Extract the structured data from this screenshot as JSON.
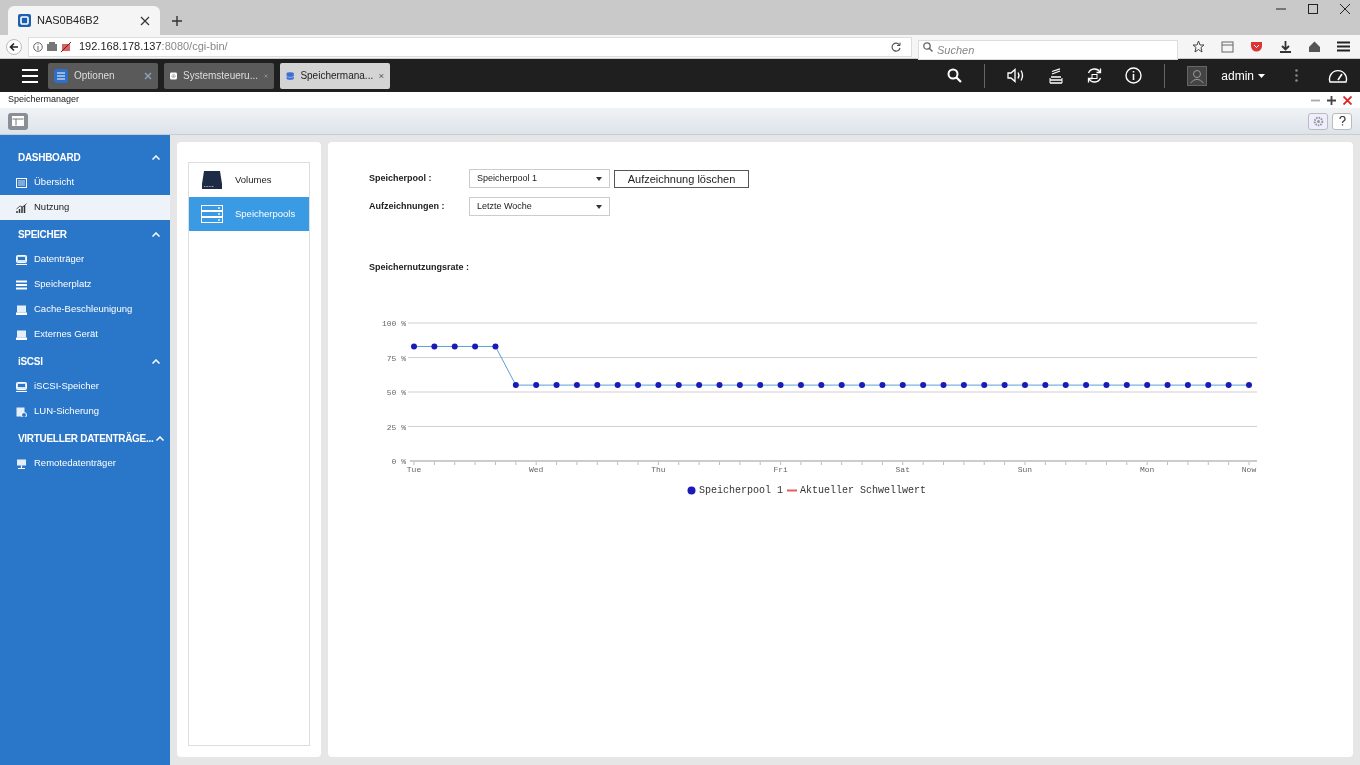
{
  "browser": {
    "tab_title": "NAS0B46B2",
    "url_host": "192.168.178.137",
    "url_rest": ":8080/cgi-bin/",
    "search": {
      "placeholder": "Suchen"
    }
  },
  "app_bar": {
    "tabs": [
      {
        "label": "Optionen",
        "selected": false
      },
      {
        "label": "Systemsteueru...",
        "selected": false
      },
      {
        "label": "Speichermana...",
        "selected": true
      }
    ],
    "user": "admin"
  },
  "window": {
    "title": "Speichermanager"
  },
  "sidebar": {
    "sections": [
      {
        "title": "DASHBOARD",
        "expanded": true,
        "items": [
          {
            "label": "Übersicht",
            "selected": false
          },
          {
            "label": "Nutzung",
            "selected": true
          }
        ]
      },
      {
        "title": "SPEICHER",
        "expanded": true,
        "items": [
          {
            "label": "Datenträger",
            "selected": false
          },
          {
            "label": "Speicherplatz",
            "selected": false
          },
          {
            "label": "Cache-Beschleunigung",
            "selected": false
          },
          {
            "label": "Externes Gerät",
            "selected": false
          }
        ]
      },
      {
        "title": "iSCSI",
        "expanded": true,
        "items": [
          {
            "label": "iSCSI-Speicher",
            "selected": false
          },
          {
            "label": "LUN-Sicherung",
            "selected": false
          }
        ]
      },
      {
        "title": "VIRTUELLER DATENTRÄGE...",
        "expanded": true,
        "items": [
          {
            "label": "Remotedatenträger",
            "selected": false
          }
        ]
      }
    ]
  },
  "subnav": [
    {
      "label": "Volumes",
      "selected": false
    },
    {
      "label": "Speicherpools",
      "selected": true
    }
  ],
  "form": {
    "pool_label": "Speicherpool :",
    "pool_value": "Speicherpool 1",
    "clear_button": "Aufzeichnung löschen",
    "records_label": "Aufzeichnungen :",
    "records_value": "Letzte Woche",
    "chart_label": "Speichernutzungsrate :"
  },
  "chart_data": {
    "type": "line",
    "categories": [
      "Tue",
      null,
      null,
      null,
      null,
      null,
      "Wed",
      null,
      null,
      null,
      null,
      null,
      "Thu",
      null,
      null,
      null,
      null,
      null,
      "Fri",
      null,
      null,
      null,
      null,
      null,
      "Sat",
      null,
      null,
      null,
      null,
      null,
      "Sun",
      null,
      null,
      null,
      null,
      null,
      "Mon",
      null,
      null,
      null,
      null,
      "Now"
    ],
    "series": [
      {
        "name": "Speicherpool 1",
        "color": "#1a1ab8",
        "marker": "circle",
        "values": [
          83,
          83,
          83,
          83,
          83,
          55,
          55,
          55,
          55,
          55,
          55,
          55,
          55,
          55,
          55,
          55,
          55,
          55,
          55,
          55,
          55,
          55,
          55,
          55,
          55,
          55,
          55,
          55,
          55,
          55,
          55,
          55,
          55,
          55,
          55,
          55,
          55,
          55,
          55,
          55,
          55,
          55
        ]
      },
      {
        "name": "Aktueller Schwellwert",
        "color": "#e06060",
        "values": [
          null,
          null,
          null,
          null,
          null,
          null,
          null,
          null,
          null,
          null,
          null,
          null,
          null,
          null,
          null,
          null,
          null,
          null,
          null,
          null,
          null,
          null,
          null,
          null,
          null,
          null,
          null,
          null,
          null,
          null,
          null,
          null,
          null,
          null,
          null,
          null,
          null,
          null,
          null,
          null,
          null,
          null
        ]
      }
    ],
    "ylim": [
      0,
      100
    ],
    "grid": true,
    "yticks": [
      {
        "value": 0,
        "label": "0 %"
      },
      {
        "value": 25,
        "label": "25 %"
      },
      {
        "value": 50,
        "label": "50 %"
      },
      {
        "value": 75,
        "label": "75 %"
      },
      {
        "value": 100,
        "label": "100 %"
      }
    ]
  }
}
